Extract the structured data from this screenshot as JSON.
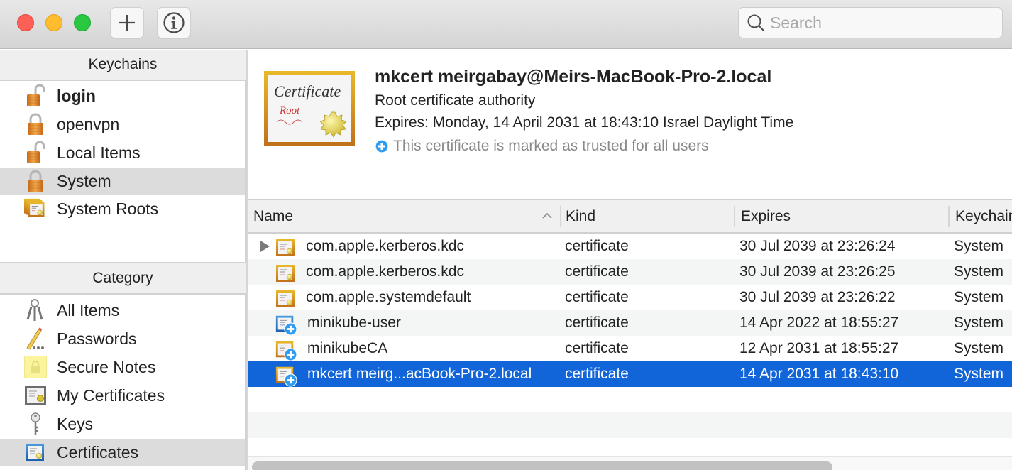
{
  "toolbar": {
    "traffic_lights": [
      "close",
      "minimize",
      "zoom"
    ],
    "add_button_icon": "plus-icon",
    "info_button_icon": "info-icon",
    "search": {
      "placeholder": "Search",
      "value": "",
      "icon": "magnifier-icon"
    }
  },
  "sidebar": {
    "keychains_header": "Keychains",
    "keychains": [
      {
        "label": "login",
        "icon": "lock-open-icon",
        "bold": true,
        "selected": false
      },
      {
        "label": "openvpn",
        "icon": "lock-closed-icon",
        "bold": false,
        "selected": false
      },
      {
        "label": "Local Items",
        "icon": "lock-open-icon",
        "bold": false,
        "selected": false
      },
      {
        "label": "System",
        "icon": "lock-closed-icon",
        "bold": false,
        "selected": true
      },
      {
        "label": "System Roots",
        "icon": "certificate-stack-icon",
        "bold": false,
        "selected": false
      }
    ],
    "category_header": "Category",
    "categories": [
      {
        "label": "All Items",
        "icon": "keys-bundle-icon",
        "selected": false
      },
      {
        "label": "Passwords",
        "icon": "pencil-dots-icon",
        "selected": false
      },
      {
        "label": "Secure Notes",
        "icon": "secure-note-icon",
        "selected": false
      },
      {
        "label": "My Certificates",
        "icon": "my-certificate-icon",
        "selected": false
      },
      {
        "label": "Keys",
        "icon": "key-icon",
        "selected": false
      },
      {
        "label": "Certificates",
        "icon": "certificate-icon",
        "selected": true
      }
    ]
  },
  "detail": {
    "image_text_top": "Certificate",
    "image_text_sub": "Root",
    "title": "mkcert meirgabay@Meirs-MacBook-Pro-2.local",
    "subtitle": "Root certificate authority",
    "expires": "Expires: Monday, 14 April 2031 at 18:43:10 Israel Daylight Time",
    "trust": "This certificate is marked as trusted for all users"
  },
  "table": {
    "columns": [
      "Name",
      "Kind",
      "Expires",
      "Keychain"
    ],
    "sort_column": "Name",
    "sort_direction": "ascending",
    "rows": [
      {
        "name": "com.apple.kerberos.kdc",
        "kind": "certificate",
        "expires": "30 Jul 2039 at 23:26:24",
        "keychain": "System",
        "icon": "certificate-gold-icon",
        "expandable": true,
        "trusted_badge": false,
        "selected": false
      },
      {
        "name": "com.apple.kerberos.kdc",
        "kind": "certificate",
        "expires": "30 Jul 2039 at 23:26:25",
        "keychain": "System",
        "icon": "certificate-gold-icon",
        "expandable": false,
        "trusted_badge": false,
        "selected": false
      },
      {
        "name": "com.apple.systemdefault",
        "kind": "certificate",
        "expires": "30 Jul 2039 at 23:26:22",
        "keychain": "System",
        "icon": "certificate-gold-icon",
        "expandable": false,
        "trusted_badge": false,
        "selected": false
      },
      {
        "name": "minikube-user",
        "kind": "certificate",
        "expires": "14 Apr 2022 at 18:55:27",
        "keychain": "System",
        "icon": "certificate-blue-icon",
        "expandable": false,
        "trusted_badge": true,
        "selected": false
      },
      {
        "name": "minikubeCA",
        "kind": "certificate",
        "expires": "12 Apr 2031 at 18:55:27",
        "keychain": "System",
        "icon": "certificate-gold-icon",
        "expandable": false,
        "trusted_badge": true,
        "selected": false
      },
      {
        "name": "mkcert meirg...acBook-Pro-2.local",
        "kind": "certificate",
        "expires": "14 Apr 2031 at 18:43:10",
        "keychain": "System",
        "icon": "certificate-gold-icon",
        "expandable": false,
        "trusted_badge": true,
        "selected": true
      }
    ]
  },
  "colors": {
    "selection": "#1165d9",
    "trust_badge": "#2f9cf0",
    "sidebar_selected": "#dcdcdc"
  }
}
